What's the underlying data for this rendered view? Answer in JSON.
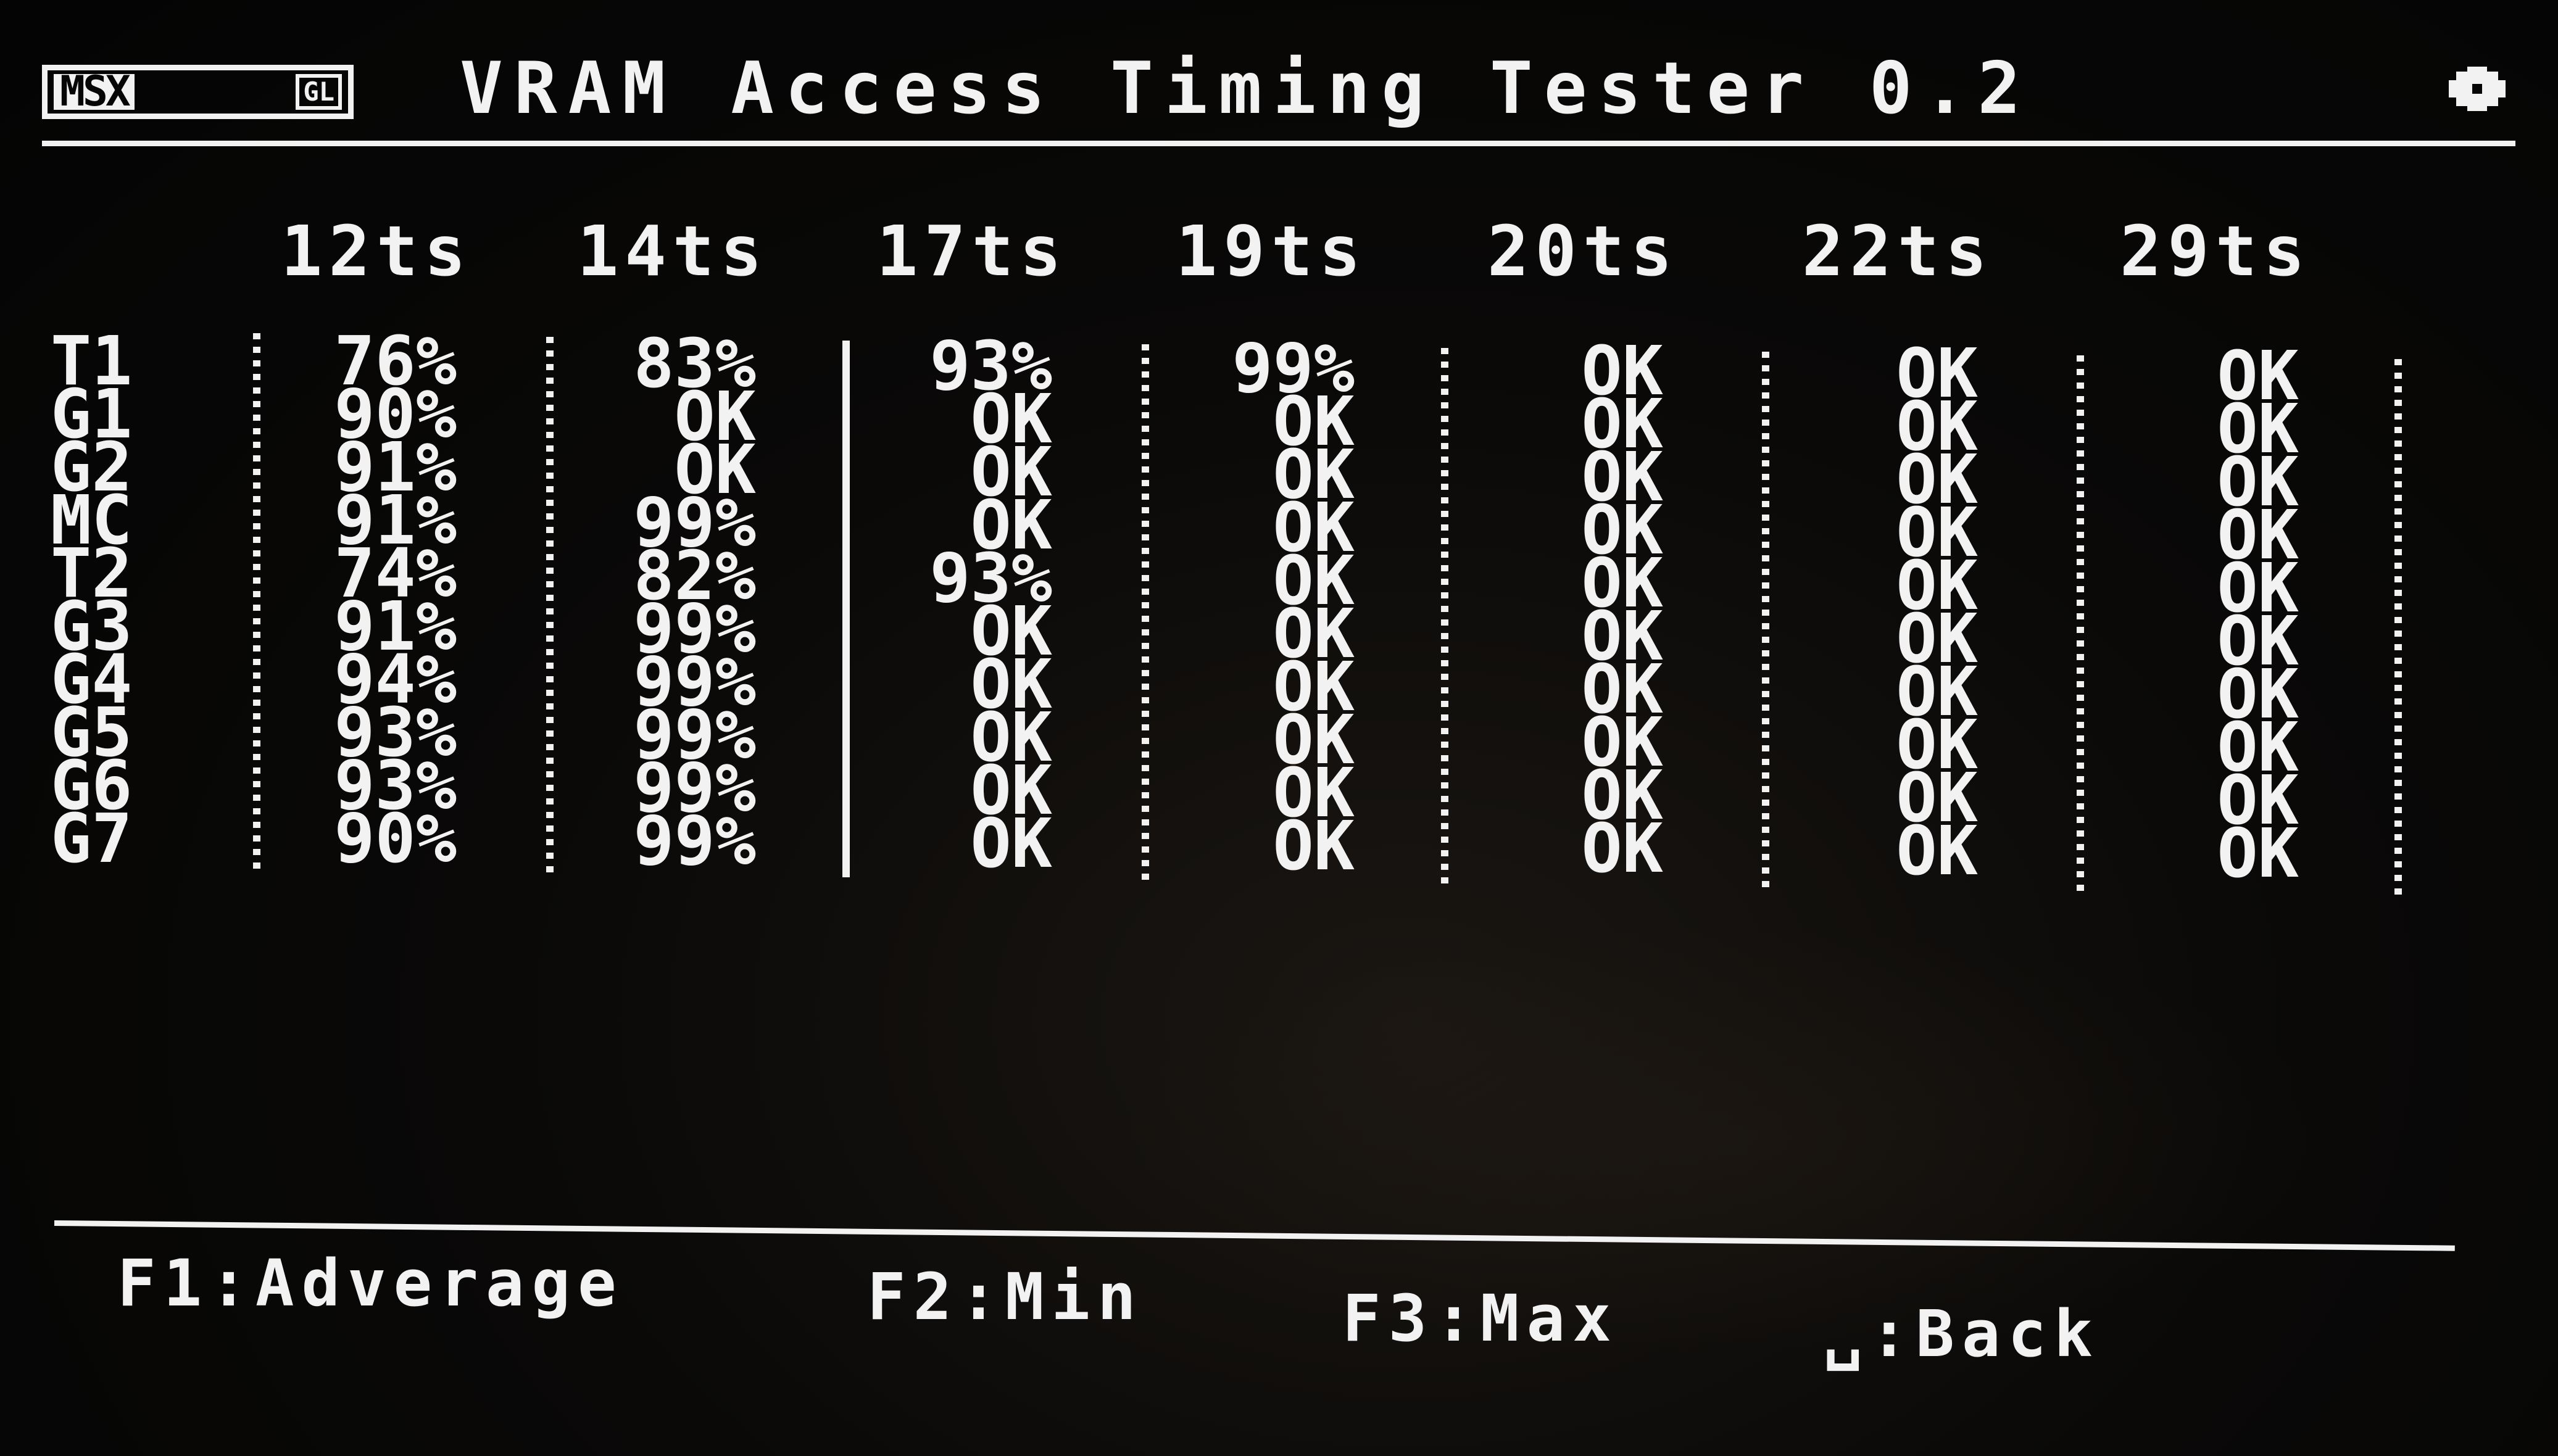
{
  "header": {
    "logo_main": "MSX",
    "logo_sub": "GL",
    "title": "VRAM Access Timing Tester 0.2"
  },
  "columns": [
    "12ts",
    "14ts",
    "17ts",
    "19ts",
    "20ts",
    "22ts",
    "29ts"
  ],
  "rows": [
    {
      "mode": "T1",
      "values": [
        "76%",
        "83%",
        "93%",
        "99%",
        "OK",
        "OK",
        "OK"
      ]
    },
    {
      "mode": "G1",
      "values": [
        "90%",
        "OK",
        "OK",
        "OK",
        "OK",
        "OK",
        "OK"
      ]
    },
    {
      "mode": "G2",
      "values": [
        "91%",
        "OK",
        "OK",
        "OK",
        "OK",
        "OK",
        "OK"
      ]
    },
    {
      "mode": "MC",
      "values": [
        "91%",
        "99%",
        "OK",
        "OK",
        "OK",
        "OK",
        "OK"
      ]
    },
    {
      "mode": "T2",
      "values": [
        "74%",
        "82%",
        "93%",
        "OK",
        "OK",
        "OK",
        "OK"
      ]
    },
    {
      "mode": "G3",
      "values": [
        "91%",
        "99%",
        "OK",
        "OK",
        "OK",
        "OK",
        "OK"
      ]
    },
    {
      "mode": "G4",
      "values": [
        "94%",
        "99%",
        "OK",
        "OK",
        "OK",
        "OK",
        "OK"
      ]
    },
    {
      "mode": "G5",
      "values": [
        "93%",
        "99%",
        "OK",
        "OK",
        "OK",
        "OK",
        "OK"
      ]
    },
    {
      "mode": "G6",
      "values": [
        "93%",
        "99%",
        "OK",
        "OK",
        "OK",
        "OK",
        "OK"
      ]
    },
    {
      "mode": "G7",
      "values": [
        "90%",
        "99%",
        "OK",
        "OK",
        "OK",
        "OK",
        "OK"
      ]
    }
  ],
  "footer": {
    "f1": "F1:Adverage",
    "f2": "F2:Min",
    "f3": "F3:Max",
    "back": "␣:Back"
  },
  "icons": {
    "settings": "gear-icon"
  },
  "colors": {
    "background": "#060606",
    "foreground": "#f2f2f2"
  }
}
